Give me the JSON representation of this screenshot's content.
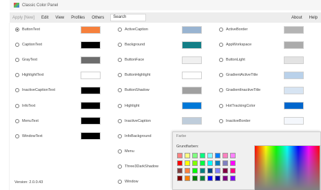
{
  "window": {
    "title": "Classic Color Panel"
  },
  "menu": {
    "apply": "Apply [New]",
    "edit": "Edit",
    "view": "View",
    "profiles": "Profiles",
    "others": "Others",
    "search_value": "Search",
    "about": "About",
    "help": "Help"
  },
  "columns": {
    "col1": [
      {
        "label": "ButtonText",
        "color": "#f6803c",
        "checked": true
      },
      {
        "label": "CaptionText",
        "color": "#000000",
        "checked": false
      },
      {
        "label": "GrayText",
        "color": "#6d6d6d",
        "checked": false
      },
      {
        "label": "HighlightText",
        "color": "#ffffff",
        "checked": false
      },
      {
        "label": "InactiveCaptionText",
        "color": "#000000",
        "checked": false
      },
      {
        "label": "InfoText",
        "color": "#000000",
        "checked": false
      },
      {
        "label": "MenuText",
        "color": "#000000",
        "checked": false
      },
      {
        "label": "WindowText",
        "color": "#000000",
        "checked": false
      }
    ],
    "col2": [
      {
        "label": "ActiveCaption",
        "color": "#99b4d1",
        "checked": false
      },
      {
        "label": "Background",
        "color": "#137f87",
        "checked": false
      },
      {
        "label": "ButtonFace",
        "color": "#f0f0f0",
        "checked": false
      },
      {
        "label": "ButtonHighlight",
        "color": "#ffffff",
        "checked": false
      },
      {
        "label": "ButtonShadow",
        "color": "#a0a0a0",
        "checked": false
      },
      {
        "label": "Highlight",
        "color": "#0078d7",
        "checked": false
      },
      {
        "label": "InactiveCaption",
        "color": "#bfcddb",
        "checked": false
      },
      {
        "label": "InfoBackground",
        "color": null,
        "checked": false
      },
      {
        "label": "Menu",
        "color": null,
        "checked": false
      },
      {
        "label": "Three3DarkShadow",
        "color": null,
        "checked": false
      },
      {
        "label": "Window",
        "color": null,
        "checked": false
      }
    ],
    "col3": [
      {
        "label": "ActiveBorder",
        "color": "#b4b4b4",
        "checked": false
      },
      {
        "label": "AppWorkspace",
        "color": "#ababab",
        "checked": false
      },
      {
        "label": "ButtonLight",
        "color": "#e3e3e3",
        "checked": false
      },
      {
        "label": "GradientActiveTitle",
        "color": "#b9d1ea",
        "checked": false
      },
      {
        "label": "GradientInactiveTitle",
        "color": "#d7e4f2",
        "checked": false
      },
      {
        "label": "HotTrackingColor",
        "color": "#0066cc",
        "checked": false
      },
      {
        "label": "InactiveBorder",
        "color": "#f4f7fc",
        "checked": false
      }
    ]
  },
  "version": "Version: 2.0.0.43",
  "picker": {
    "title": "Farbe",
    "basic_label": "Grundfarben:",
    "basic_colors": [
      "#ff8080",
      "#ffff80",
      "#80ff80",
      "#00ff80",
      "#80ffff",
      "#0080ff",
      "#ff80c0",
      "#ff80ff",
      "#ff0000",
      "#ffff00",
      "#80ff00",
      "#00ff40",
      "#00ffff",
      "#0080c0",
      "#8080c0",
      "#ff00ff",
      "#804040",
      "#ff8040",
      "#00ff00",
      "#008080",
      "#004080",
      "#8080ff",
      "#800040",
      "#ff0080",
      "#800000",
      "#ff8000",
      "#008000",
      "#008040",
      "#0000ff",
      "#0000a0",
      "#800080",
      "#8000ff"
    ]
  }
}
